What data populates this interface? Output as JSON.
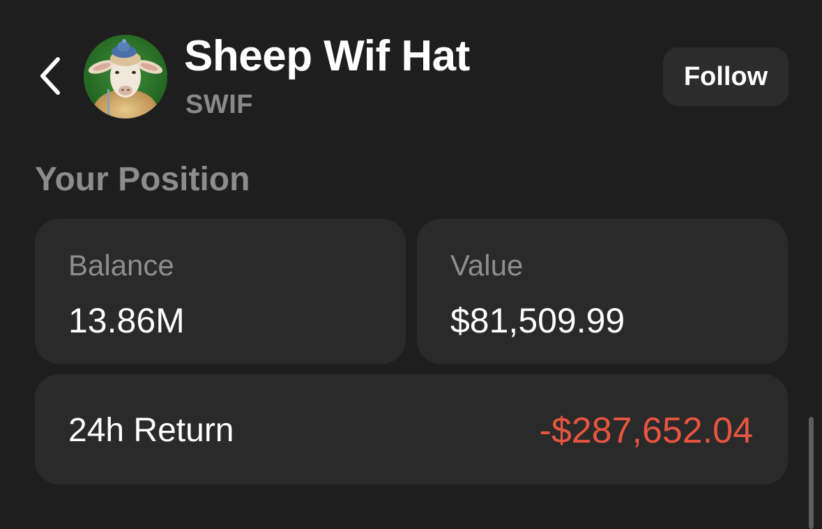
{
  "header": {
    "back_icon": "chevron-left-icon",
    "token_name": "Sheep Wif Hat",
    "token_symbol": "SWIF",
    "follow_label": "Follow",
    "avatar_description": "sheep-wearing-blue-hat"
  },
  "position": {
    "section_title": "Your Position",
    "balance": {
      "label": "Balance",
      "value": "13.86M"
    },
    "value": {
      "label": "Value",
      "value": "$81,509.99"
    },
    "return_24h": {
      "label": "24h Return",
      "value": "-$287,652.04",
      "color": "#e8553f"
    }
  },
  "colors": {
    "background": "#1e1e1e",
    "card": "#2a2a2a",
    "muted_text": "#8c8c8c",
    "negative": "#e8553f"
  }
}
